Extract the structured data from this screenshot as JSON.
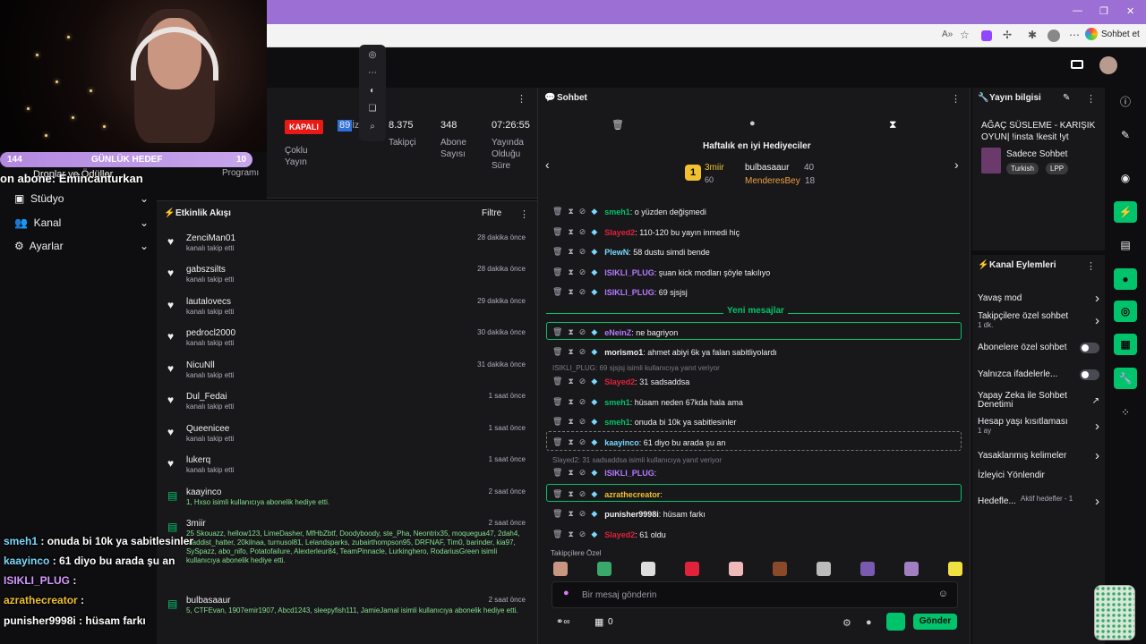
{
  "browser": {
    "sohbet_et": "Sohbet et"
  },
  "goal": {
    "left": "144",
    "label": "GÜNLÜK HEDEF",
    "right": "10"
  },
  "overlay_sub_text": "on abone: Emincanturkan",
  "overlay_dropsdaki": "Droplar ve Ödüller",
  "sidebar": {
    "items": [
      {
        "label": "Stüdyo",
        "icon": "studio-icon"
      },
      {
        "label": "Kanal",
        "icon": "channel-icon"
      },
      {
        "label": "Ayarlar",
        "icon": "settings-icon"
      }
    ]
  },
  "stats": {
    "status": "KAPALI",
    "multistream": "Çoklu\nYayın",
    "viewers": "89",
    "viewers_label": "İzleyici",
    "followers": "8.375",
    "followers_label": "Takipçi",
    "subs": "348",
    "subs_label": "Abone\nSayısı",
    "uptime": "07:26:55",
    "uptime_label": "Yayında\nOlduğu\nSüre",
    "program": "Programı"
  },
  "activity": {
    "title": "Etkinlik Akışı",
    "filter": "Filtre",
    "items": [
      {
        "icon": "heart-icon",
        "name": "ZenciMan01",
        "sub": "kanalı takip etti",
        "time": "28 dakika önce"
      },
      {
        "icon": "heart-icon",
        "name": "gabszsilts",
        "sub": "kanalı takip etti",
        "time": "28 dakika önce"
      },
      {
        "icon": "heart-icon",
        "name": "lautalovecs",
        "sub": "kanalı takip etti",
        "time": "29 dakika önce"
      },
      {
        "icon": "heart-icon",
        "name": "pedrocl2000",
        "sub": "kanalı takip etti",
        "time": "30 dakika önce"
      },
      {
        "icon": "heart-icon",
        "name": "NicuNll",
        "sub": "kanalı takip etti",
        "time": "31 dakika önce"
      },
      {
        "icon": "heart-icon",
        "name": "Dul_Fedai",
        "sub": "kanalı takip etti",
        "time": "1 saat önce"
      },
      {
        "icon": "heart-icon",
        "name": "Queenicee",
        "sub": "kanalı takip etti",
        "time": "1 saat önce"
      },
      {
        "icon": "heart-icon",
        "name": "lukerq",
        "sub": "kanalı takip etti",
        "time": "1 saat önce"
      },
      {
        "icon": "gift-icon",
        "name": "kaayinco",
        "sub": "1, Hxso isimli kullanıcıya abonelik hediye etti.",
        "time": "2 saat önce"
      },
      {
        "icon": "gift-icon",
        "name": "3miir",
        "sub": "25 Skouazz, hellow123, LimeDasher, MfHbZbtf, Doodyboody, ste_Pha, Neontrix35, moquegua47, 2dah4, maddist_hatter, 20kilnaa, turnusol81, Lelandsparks, zubairthompson95, DRFNAF, Tim0, barinder, kia97, SySpazz, abo_nifo, Potatofailure, Alexterleur84, TeamPinnacle, Lurkinghero, RodariusGreen isimli kullanıcıya abonelik hediye etti.",
        "time": "2 saat önce"
      },
      {
        "icon": "gift-icon",
        "name": "bulbasaaur",
        "sub": "5, CTFEvan, 1907emir1907, Abcd1243, sleepyfish111, JamieJamal isimli kullanıcıya abonelik hediye etti.",
        "time": "2 saat önce"
      }
    ]
  },
  "chat": {
    "title": "Sohbet",
    "leaderboard_title": "Haftalık en iyi Hediyeciler",
    "top1": {
      "name": "3miir",
      "count": "60"
    },
    "top2": {
      "name": "bulbasaaur",
      "count": "40"
    },
    "top3": {
      "name": "MenderesBey",
      "count": "18"
    },
    "new_messages": "Yeni mesajlar",
    "messages": [
      {
        "user": "smeh1",
        "color": "#00c36b",
        "text": ": o yüzden değişmedi"
      },
      {
        "user": "Slayed2",
        "color": "#e0223a",
        "text": ": 110-120 bu yayın inmedi hiç"
      },
      {
        "user": "PlewN",
        "color": "#7ad8ff",
        "text": ": 58 dustu simdi bende"
      },
      {
        "user": "ISIKLI_PLUG",
        "color": "#b57aff",
        "text": ": şuan kick modları şöyle takılıyo"
      },
      {
        "user": "ISIKLI_PLUG",
        "color": "#b57aff",
        "text": ": 69 sjsjsj"
      },
      {
        "user": "eNeinZ",
        "color": "#b57aff",
        "text": ": ne bagriyon"
      },
      {
        "user": "morismo1",
        "color": "#efeff1",
        "text": ": ahmet abiyi 6k ya falan sabitliyolardı"
      },
      {
        "user": "Slayed2",
        "color": "#e0223a",
        "text": ": 31 sadsaddsa"
      },
      {
        "user": "smeh1",
        "color": "#00c36b",
        "text": ": hüsam neden 67kda hala ama"
      },
      {
        "user": "smeh1",
        "color": "#00c36b",
        "text": ": onuda bi 10k ya sabitlesinler"
      },
      {
        "user": "kaayinco",
        "color": "#7ad8ff",
        "text": ": 61 diyo bu arada şu an"
      },
      {
        "user": "ISIKLI_PLUG",
        "color": "#b57aff",
        "text": ":"
      },
      {
        "user": "azrathecreator",
        "color": "#f0c030",
        "text": ":"
      },
      {
        "user": "punisher9998i",
        "color": "#efeff1",
        "text": ": hüsam farkı"
      },
      {
        "user": "Slayed2",
        "color": "#e0223a",
        "text": ": 61 oldu"
      }
    ],
    "reply1": "ISIKLI_PLUG: 69 sjsjsj isimli kullanıcıya yanıt veriyor",
    "reply2": "Slayed2: 31 sadsaddsa isimli kullanıcıya yanıt veriyor",
    "emote_label": "Takipçilere Özel",
    "input_placeholder": "Bir mesaj gönderin",
    "points": "0",
    "send": "Gönder"
  },
  "stream_info": {
    "title": "Yayın bilgisi",
    "stream_title": "AĞAÇ SÜSLEME - KARIŞIK OYUN| !insta !kesit !yt",
    "category": "Sadece Sohbet",
    "tags": [
      "Turkish",
      "LPP"
    ]
  },
  "channel_actions": {
    "title": "Kanal Eylemleri",
    "items": [
      {
        "label": "Yavaş mod",
        "sub": "",
        "ctrl": "chevron"
      },
      {
        "label": "Takipçilere özel sohbet",
        "sub": "1 dk.",
        "ctrl": "chevron"
      },
      {
        "label": "Abonelere özel sohbet",
        "sub": "",
        "ctrl": "toggle"
      },
      {
        "label": "Yalnızca ifadelerle...",
        "sub": "",
        "ctrl": "toggle"
      },
      {
        "label": "Yapay Zeka ile Sohbet Denetimi",
        "sub": "",
        "ctrl": "link"
      },
      {
        "label": "Hesap yaşı kısıtlaması",
        "sub": "1 ay",
        "ctrl": "chevron"
      },
      {
        "label": "Yasaklanmış kelimeler",
        "sub": "",
        "ctrl": "chevron"
      },
      {
        "label": "İzleyici Yönlendir",
        "sub": "",
        "ctrl": "none"
      },
      {
        "label": "Hedefle...",
        "sub": "Aktif hedefler - 1",
        "ctrl": "chevron"
      }
    ]
  },
  "overlay": {
    "lines": [
      {
        "user": "smeh1",
        "text": " : onuda bi 10k ya sabitlesinler",
        "color": "#7ad8ff"
      },
      {
        "user": "kaayinco",
        "text": " : 61 diyo bu arada şu an",
        "color": "#7ad8ff"
      },
      {
        "user": "ISIKLI_PLUG",
        "text": " :",
        "color": "#d59bff"
      },
      {
        "user": "azrathecreator",
        "text": " :",
        "color": "#f0c030"
      },
      {
        "user": "punisher9998i",
        "text": " : hüsam farkı",
        "color": "#ffffff"
      }
    ]
  }
}
